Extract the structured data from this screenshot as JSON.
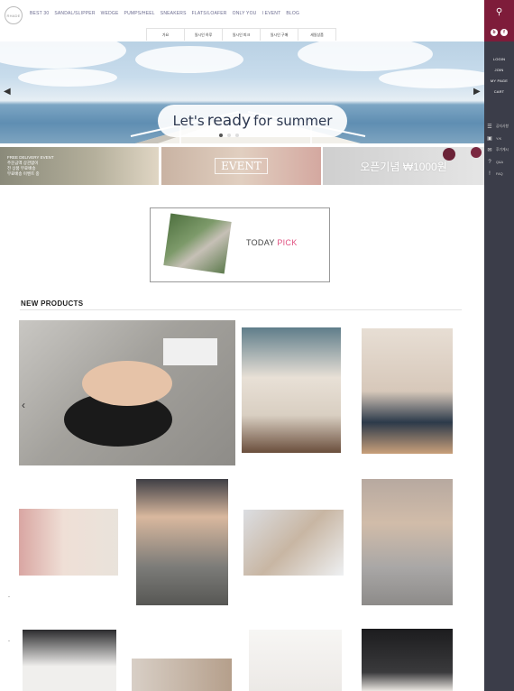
{
  "header": {
    "logo_text": "RHADE",
    "top_nav": [
      "BEST 30",
      "SANDAL/SLIPPER",
      "WEDGE",
      "PUMPS/HEEL",
      "SNEAKERS",
      "FLATS/LOAFER",
      "ONLY YOU",
      "I EVENT",
      "BLOG"
    ],
    "sub_nav": [
      "가요",
      "일시인 하루",
      "일시인 피크",
      "일시인 구매",
      "세일상품"
    ]
  },
  "banner": {
    "text_pre": "Let's",
    "text_big": "ready",
    "text_post": "for summer",
    "prev_icon": "chevron-left-icon",
    "next_icon": "chevron-right-icon"
  },
  "promos": [
    {
      "text": "FREE DELIVERY EVENT\n주문금액 상관없이\n전 상품 무료배송\n무료배송 이벤트 중"
    },
    {
      "text": "EVENT"
    },
    {
      "text": "오픈기념 ₩1000원"
    }
  ],
  "today_pick": {
    "today": "TODAY",
    "pick": "PICK"
  },
  "new_products": {
    "title": "NEW PRODUCTS",
    "prev_icon": "chevron-left-icon"
  },
  "sidebar": {
    "search_icon": "search-icon",
    "social": [
      "b",
      "f"
    ],
    "links": [
      "LOGIN",
      "JOIN",
      "MY PAGE",
      "CART"
    ],
    "icons": [
      {
        "icon": "menu-icon",
        "label": "공지사항"
      },
      {
        "icon": "camera-icon",
        "label": "Y/K"
      },
      {
        "icon": "chat-icon",
        "label": "후기게시"
      },
      {
        "icon": "question-icon",
        "label": "Q&A"
      },
      {
        "icon": "alert-icon",
        "label": "FAQ"
      }
    ]
  },
  "colors": {
    "sidebar_bg": "#3b3d49",
    "accent": "#7e1c3a",
    "nav_text": "#6a6a8e"
  }
}
